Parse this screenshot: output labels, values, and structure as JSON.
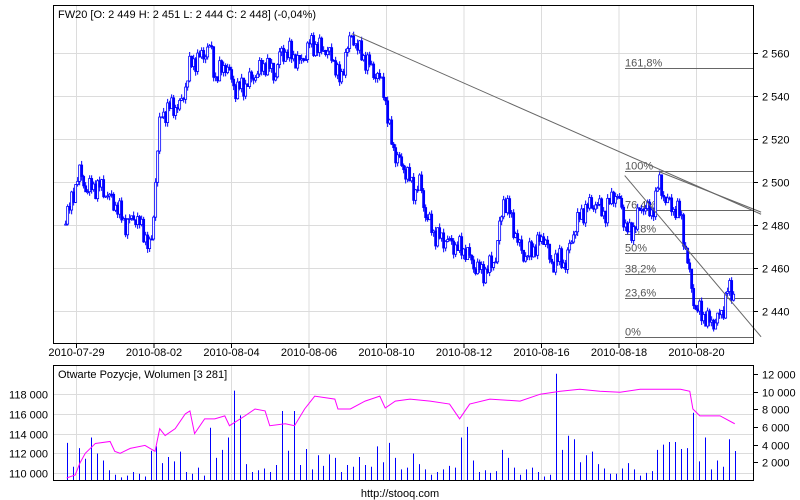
{
  "chart_data": [
    {
      "type": "candlestick",
      "title": "FW20 [O: 2 449  H: 2 451  L: 2 444  C: 2 448] (-0,04%)",
      "ylim": [
        2425,
        2572
      ],
      "yticks": [
        "2 440",
        "2 460",
        "2 480",
        "2 500",
        "2 520",
        "2 540",
        "2 560"
      ],
      "ytick_values": [
        2440,
        2460,
        2480,
        2500,
        2520,
        2540,
        2560
      ],
      "xticks": [
        "2010-07-29",
        "2010-08-02",
        "2010-08-04",
        "2010-08-06",
        "2010-08-10",
        "2010-08-12",
        "2010-08-16",
        "2010-08-18",
        "2010-08-20"
      ],
      "grid": true,
      "series_color": "#0000ff",
      "price_path": [
        [
          -0.14,
          2485
        ],
        [
          -0.08,
          2488
        ],
        [
          0.03,
          2505
        ],
        [
          0.12,
          2497
        ],
        [
          0.31,
          2498
        ],
        [
          0.44,
          2492
        ],
        [
          0.53,
          2488
        ],
        [
          0.63,
          2480
        ],
        [
          0.76,
          2484
        ],
        [
          0.89,
          2475
        ],
        [
          0.95,
          2468
        ],
        [
          0.99,
          2480
        ],
        [
          1.02,
          2502
        ],
        [
          1.08,
          2530
        ],
        [
          1.21,
          2535
        ],
        [
          1.34,
          2535
        ],
        [
          1.41,
          2545
        ],
        [
          1.47,
          2555
        ],
        [
          1.6,
          2558
        ],
        [
          1.73,
          2563
        ],
        [
          1.79,
          2548
        ],
        [
          1.92,
          2555
        ],
        [
          2.05,
          2543
        ],
        [
          2.18,
          2545
        ],
        [
          2.31,
          2550
        ],
        [
          2.44,
          2555
        ],
        [
          2.57,
          2550
        ],
        [
          2.63,
          2560
        ],
        [
          2.76,
          2560
        ],
        [
          2.89,
          2555
        ],
        [
          3.02,
          2565
        ],
        [
          3.12,
          2562
        ],
        [
          3.21,
          2562
        ],
        [
          3.34,
          2555
        ],
        [
          3.41,
          2545
        ],
        [
          3.47,
          2560
        ],
        [
          3.56,
          2568
        ],
        [
          3.66,
          2560
        ],
        [
          3.77,
          2555
        ],
        [
          3.86,
          2550
        ],
        [
          3.96,
          2545
        ],
        [
          4.03,
          2525
        ],
        [
          4.12,
          2512
        ],
        [
          4.25,
          2505
        ],
        [
          4.37,
          2495
        ],
        [
          4.44,
          2500
        ],
        [
          4.5,
          2485
        ],
        [
          4.63,
          2475
        ],
        [
          4.76,
          2473
        ],
        [
          4.89,
          2470
        ],
        [
          5.02,
          2468
        ],
        [
          5.15,
          2460
        ],
        [
          5.28,
          2458
        ],
        [
          5.41,
          2465
        ],
        [
          5.51,
          2492
        ],
        [
          5.6,
          2485
        ],
        [
          5.69,
          2472
        ],
        [
          5.79,
          2465
        ],
        [
          5.92,
          2470
        ],
        [
          6.05,
          2475
        ],
        [
          6.12,
          2460
        ],
        [
          6.18,
          2465
        ],
        [
          6.31,
          2462
        ],
        [
          6.44,
          2480
        ],
        [
          6.57,
          2488
        ],
        [
          6.7,
          2490
        ],
        [
          6.83,
          2485
        ],
        [
          6.92,
          2495
        ],
        [
          7.02,
          2490
        ],
        [
          7.08,
          2480
        ],
        [
          7.15,
          2475
        ],
        [
          7.25,
          2485
        ],
        [
          7.34,
          2490
        ],
        [
          7.41,
          2483
        ],
        [
          7.51,
          2500
        ],
        [
          7.6,
          2492
        ],
        [
          7.69,
          2488
        ],
        [
          7.8,
          2485
        ],
        [
          7.87,
          2465
        ],
        [
          7.92,
          2455
        ],
        [
          7.99,
          2440
        ],
        [
          8.05,
          2440
        ],
        [
          8.15,
          2435
        ],
        [
          8.25,
          2435
        ],
        [
          8.34,
          2440
        ],
        [
          8.4,
          2450
        ],
        [
          8.48,
          2448
        ]
      ],
      "fibonacci": {
        "color": "#666666",
        "levels": [
          {
            "label": "161,8%",
            "value": 2553
          },
          {
            "label": "100%",
            "value": 2505
          },
          {
            "label": "76,4%",
            "value": 2487
          },
          {
            "label": "61,8%",
            "value": 2476
          },
          {
            "label": "50%",
            "value": 2467
          },
          {
            "label": "38,2%",
            "value": 2457
          },
          {
            "label": "23,6%",
            "value": 2446
          },
          {
            "label": "0%",
            "value": 2428
          }
        ]
      },
      "trendlines": [
        [
          [
            3.56,
            2569
          ],
          [
            8.84,
            2485
          ]
        ],
        [
          [
            7.51,
            2505
          ],
          [
            8.84,
            2486
          ]
        ],
        [
          [
            7.08,
            2503
          ],
          [
            8.84,
            2428
          ]
        ]
      ]
    },
    {
      "type": "bar+line",
      "title": "Otwarte Pozycje, Wolumen [3 281]",
      "left_ylim": [
        109300,
        119500
      ],
      "left_yticks": [
        "110 000",
        "112 000",
        "114 000",
        "116 000",
        "118 000"
      ],
      "left_ytick_values": [
        110000,
        112000,
        114000,
        116000,
        118000
      ],
      "right_ylim": [
        0,
        13000
      ],
      "right_yticks": [
        "2 000",
        "4 000",
        "6 000",
        "8 000",
        "10 000",
        "12 000"
      ],
      "right_ytick_values": [
        2000,
        4000,
        6000,
        8000,
        10000,
        12000
      ],
      "oi_color": "#ff00ff",
      "volume_color": "#0000ff",
      "open_interest": [
        [
          -0.12,
          109500
        ],
        [
          -0.01,
          109800
        ],
        [
          0.05,
          111000
        ],
        [
          0.12,
          112000
        ],
        [
          0.25,
          113000
        ],
        [
          0.44,
          113200
        ],
        [
          0.5,
          112200
        ],
        [
          0.57,
          112000
        ],
        [
          0.7,
          112500
        ],
        [
          0.89,
          112800
        ],
        [
          1.02,
          112200
        ],
        [
          1.08,
          114500
        ],
        [
          1.15,
          113800
        ],
        [
          1.28,
          114500
        ],
        [
          1.41,
          116000
        ],
        [
          1.47,
          116300
        ],
        [
          1.53,
          114000
        ],
        [
          1.66,
          115500
        ],
        [
          1.79,
          115500
        ],
        [
          1.92,
          115800
        ],
        [
          1.98,
          114800
        ],
        [
          2.18,
          115800
        ],
        [
          2.31,
          116500
        ],
        [
          2.44,
          116300
        ],
        [
          2.5,
          114800
        ],
        [
          2.7,
          115000
        ],
        [
          2.82,
          114800
        ],
        [
          2.95,
          116500
        ],
        [
          3.08,
          117800
        ],
        [
          3.34,
          117500
        ],
        [
          3.38,
          116500
        ],
        [
          3.54,
          116500
        ],
        [
          3.73,
          117300
        ],
        [
          3.92,
          117800
        ],
        [
          3.99,
          116600
        ],
        [
          4.12,
          117300
        ],
        [
          4.31,
          117500
        ],
        [
          4.57,
          117300
        ],
        [
          4.82,
          117000
        ],
        [
          4.95,
          115500
        ],
        [
          5.08,
          117000
        ],
        [
          5.34,
          117500
        ],
        [
          5.73,
          117300
        ],
        [
          5.99,
          118000
        ],
        [
          6.25,
          118300
        ],
        [
          6.5,
          118500
        ],
        [
          6.76,
          118300
        ],
        [
          7.02,
          118200
        ],
        [
          7.28,
          118500
        ],
        [
          7.54,
          118500
        ],
        [
          7.8,
          118500
        ],
        [
          7.92,
          118300
        ],
        [
          7.96,
          116500
        ],
        [
          8.05,
          115800
        ],
        [
          8.31,
          115800
        ],
        [
          8.5,
          115000
        ]
      ],
      "volume": [
        4200,
        1500,
        3600,
        2400,
        4800,
        3000,
        2200,
        1100,
        600,
        300,
        500,
        900,
        700,
        400,
        3300,
        3800,
        1900,
        2600,
        2100,
        3200,
        900,
        700,
        1400,
        500,
        5900,
        2500,
        3400,
        4800,
        10100,
        7300,
        1800,
        900,
        1100,
        1300,
        900,
        1700,
        7800,
        3300,
        7800,
        1700,
        3500,
        1200,
        2800,
        1600,
        2900,
        2500,
        900,
        1700,
        1500,
        2600,
        1700,
        1500,
        3800,
        2000,
        4200,
        2500,
        1200,
        1400,
        3000,
        1800,
        1200,
        600,
        900,
        1200,
        1600,
        1400,
        4800,
        6000,
        2200,
        900,
        1100,
        800,
        1000,
        3400,
        2500,
        1400,
        600,
        1200,
        1400,
        900,
        400,
        600,
        12000,
        3400,
        5000,
        4600,
        2000,
        2800,
        3200,
        1800,
        1300,
        700,
        700,
        1300,
        1900,
        1200,
        500,
        800,
        1000,
        3400,
        4000,
        4300,
        4300,
        3500,
        3600,
        7600,
        2100,
        4800,
        1200,
        2200,
        1500,
        4600,
        3281
      ]
    }
  ],
  "footer": "http://stooq.com"
}
